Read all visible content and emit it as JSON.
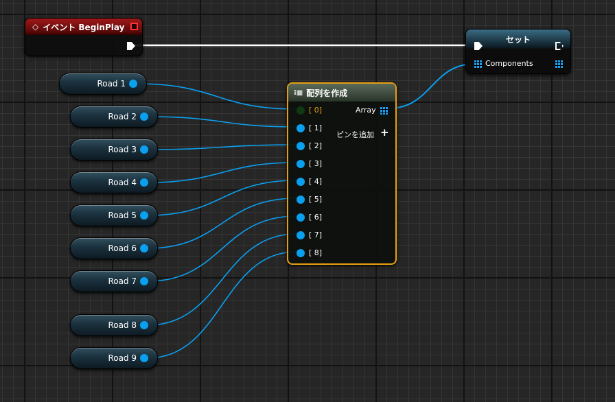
{
  "event_node": {
    "title": "イベント BeginPlay"
  },
  "variables": [
    {
      "label": "Road 1"
    },
    {
      "label": "Road 2"
    },
    {
      "label": "Road 3"
    },
    {
      "label": "Road 4"
    },
    {
      "label": "Road 5"
    },
    {
      "label": "Road 6"
    },
    {
      "label": "Road 7"
    },
    {
      "label": "Road 8"
    },
    {
      "label": "Road 9"
    }
  ],
  "make_array": {
    "title": "配列を作成",
    "pins": [
      "[ 0]",
      "[ 1]",
      "[ 2]",
      "[ 3]",
      "[ 4]",
      "[ 5]",
      "[ 6]",
      "[ 7]",
      "[ 8]"
    ],
    "output": "Array",
    "add_pin": "ピンを追加"
  },
  "set_node": {
    "title": "セット",
    "input": "Components"
  },
  "colors": {
    "wire": "#0aa0f0",
    "selected": "#e8a010",
    "event": "#a01818"
  }
}
